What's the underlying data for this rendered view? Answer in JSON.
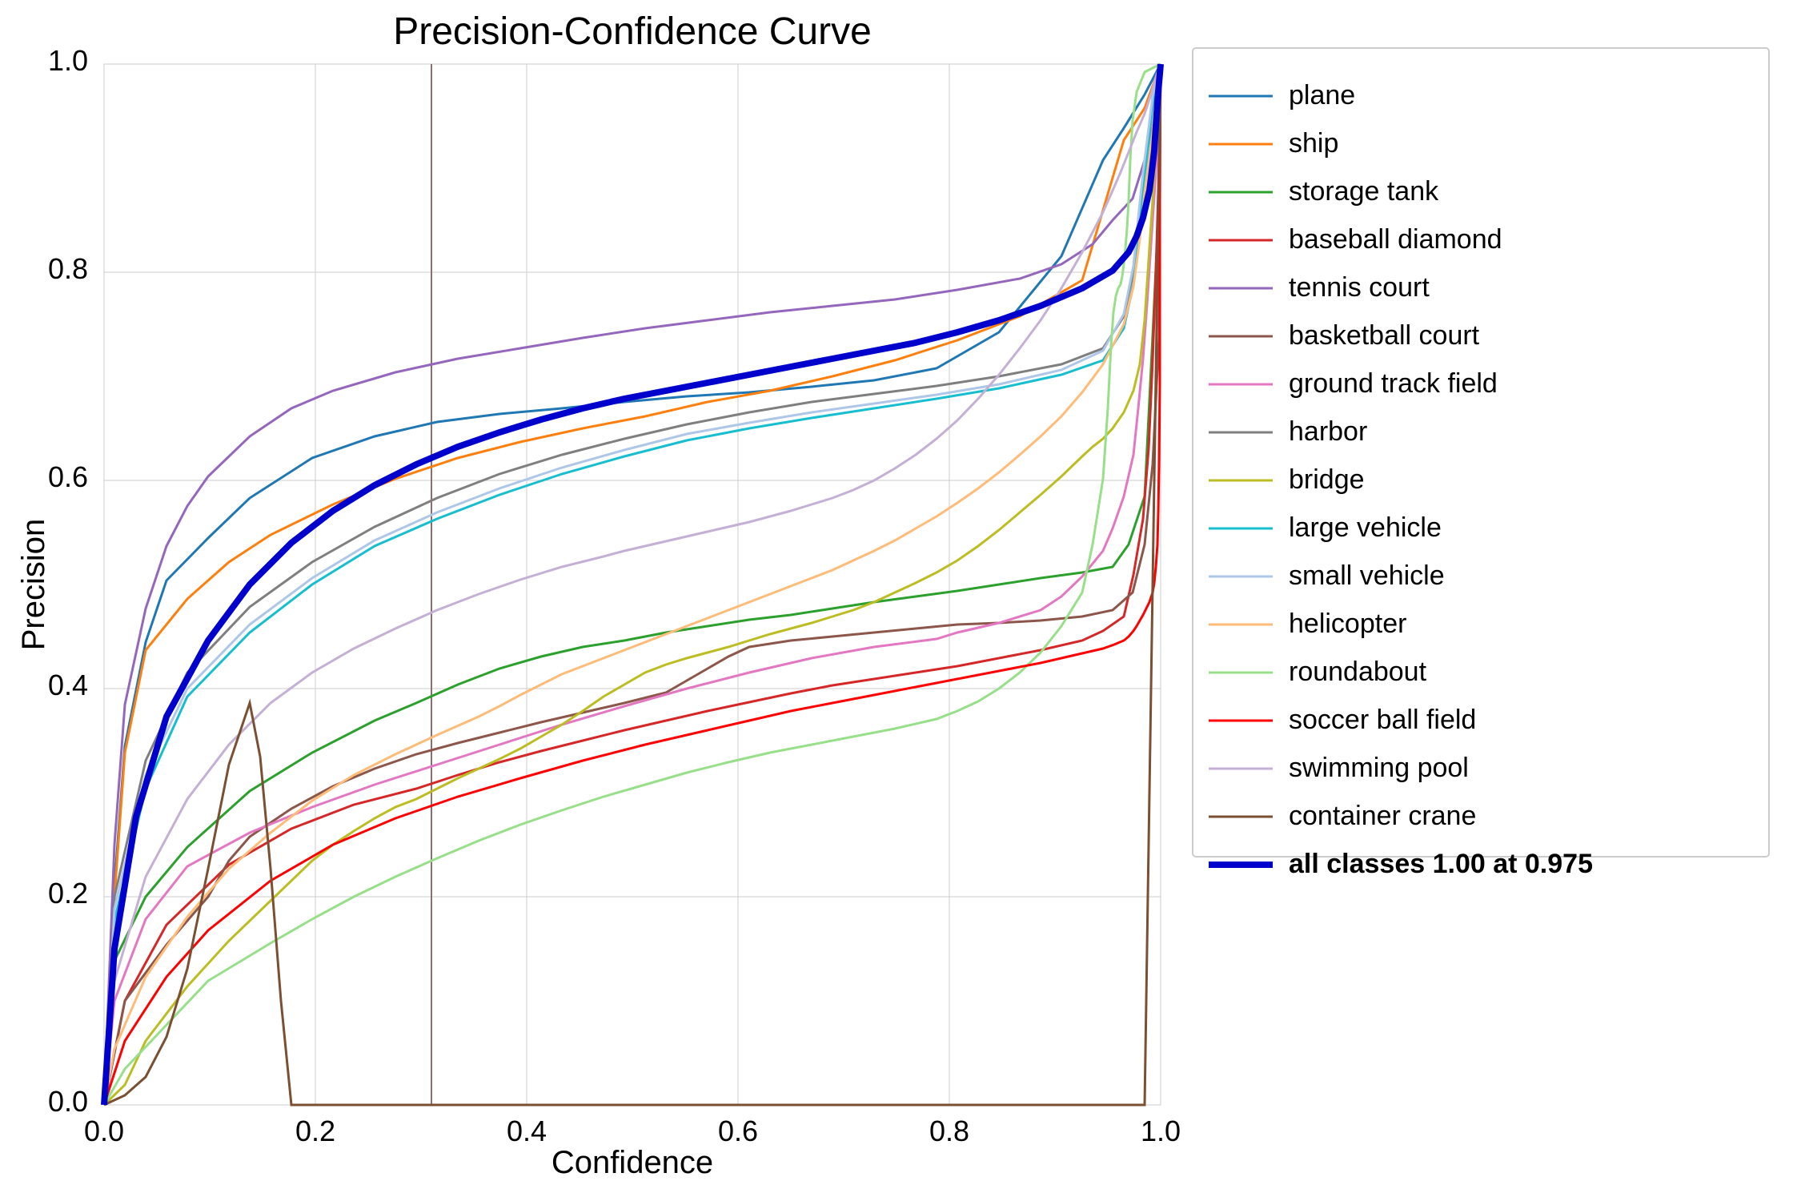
{
  "title": "Precision-Confidence Curve",
  "xAxisLabel": "Confidence",
  "yAxisLabel": "Precision",
  "legend": [
    {
      "label": "plane",
      "color": "#1f77b4",
      "bold": false
    },
    {
      "label": "ship",
      "color": "#ff7f0e",
      "bold": false
    },
    {
      "label": "storage tank",
      "color": "#2ca02c",
      "bold": false
    },
    {
      "label": "baseball diamond",
      "color": "#d62728",
      "bold": false
    },
    {
      "label": "tennis court",
      "color": "#9467bd",
      "bold": false
    },
    {
      "label": "basketball court",
      "color": "#8c564b",
      "bold": false
    },
    {
      "label": "ground track field",
      "color": "#e377c2",
      "bold": false
    },
    {
      "label": "harbor",
      "color": "#7f7f7f",
      "bold": false
    },
    {
      "label": "bridge",
      "color": "#bcbd22",
      "bold": false
    },
    {
      "label": "large vehicle",
      "color": "#17becf",
      "bold": false
    },
    {
      "label": "small vehicle",
      "color": "#aec7e8",
      "bold": false
    },
    {
      "label": "helicopter",
      "color": "#ffbb78",
      "bold": false
    },
    {
      "label": "roundabout",
      "color": "#98df8a",
      "bold": false
    },
    {
      "label": "soccer ball field",
      "color": "#ff0000",
      "bold": false
    },
    {
      "label": "swimming pool",
      "color": "#c5b0d5",
      "bold": false
    },
    {
      "label": "container crane",
      "color": "#7b4f32",
      "bold": false
    },
    {
      "label": "all classes 1.00 at 0.975",
      "color": "#0000cd",
      "bold": true
    }
  ],
  "verticalLine": {
    "x": 0.31,
    "color": "#8b6e6e"
  },
  "xTicks": [
    "0.0",
    "0.2",
    "0.4",
    "0.6",
    "0.8",
    "1.0"
  ],
  "yTicks": [
    "0.0",
    "0.2",
    "0.4",
    "0.6",
    "0.8",
    "1.0"
  ]
}
